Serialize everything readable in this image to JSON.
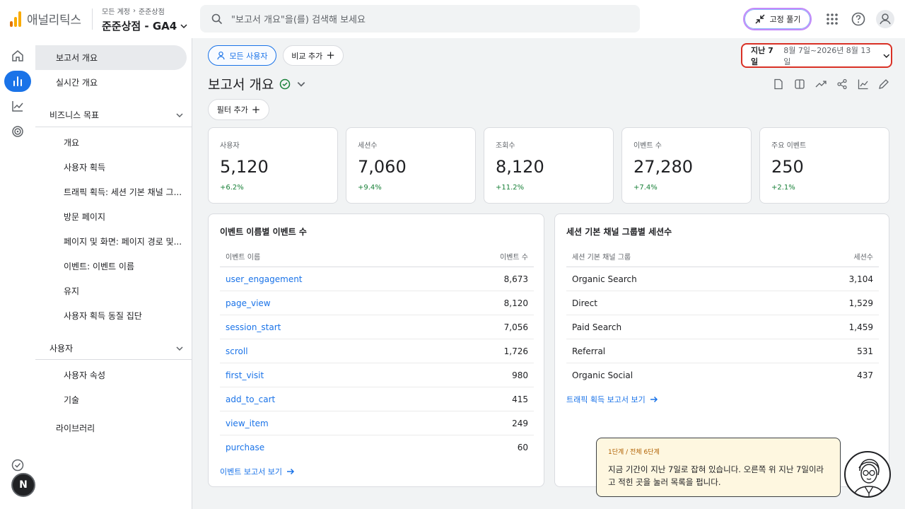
{
  "app": {
    "name": "애널리틱스",
    "crumb_root": "모든 계정",
    "crumb_sub": "준준상점",
    "property": "준준상점 - GA4"
  },
  "search": {
    "placeholder": "\"보고서 개요\"을(를) 검색해 보세요"
  },
  "header": {
    "pin_label": "고정 풀기"
  },
  "sidebar": {
    "overview": "보고서 개요",
    "realtime": "실시간 개요",
    "business_goals": "비즈니스 목표",
    "business_items": [
      "개요",
      "사용자 획득",
      "트래픽 획득: 세션 기본 채널 그...",
      "방문 페이지",
      "페이지 및 화면: 페이지 경로 및...",
      "이벤트: 이벤트 이름",
      "유지",
      "사용자 획득 동질 집단"
    ],
    "users_group": "사용자",
    "users_items": [
      "사용자 속성",
      "기술"
    ],
    "library": "라이브러리"
  },
  "filters": {
    "all_users": "모든 사용자",
    "add_compare": "비교 추가",
    "add_filter": "필터 추가"
  },
  "date_range": {
    "label": "지난 7일",
    "value": "8월 7일~2026년 8월 13일"
  },
  "page": {
    "title": "보고서 개요"
  },
  "kpis": [
    {
      "label": "사용자",
      "value": "5,120",
      "delta": "+6.2%"
    },
    {
      "label": "세션수",
      "value": "7,060",
      "delta": "+9.4%"
    },
    {
      "label": "조회수",
      "value": "8,120",
      "delta": "+11.2%"
    },
    {
      "label": "이벤트 수",
      "value": "27,280",
      "delta": "+7.4%"
    },
    {
      "label": "주요 이벤트",
      "value": "250",
      "delta": "+2.1%"
    }
  ],
  "events_card": {
    "title": "이벤트 이름별 이벤트 수",
    "col_name": "이벤트 이름",
    "col_value": "이벤트 수",
    "rows": [
      {
        "name": "user_engagement",
        "value": "8,673"
      },
      {
        "name": "page_view",
        "value": "8,120"
      },
      {
        "name": "session_start",
        "value": "7,056"
      },
      {
        "name": "scroll",
        "value": "1,726"
      },
      {
        "name": "first_visit",
        "value": "980"
      },
      {
        "name": "add_to_cart",
        "value": "415"
      },
      {
        "name": "view_item",
        "value": "249"
      },
      {
        "name": "purchase",
        "value": "60"
      }
    ],
    "link": "이벤트 보고서 보기"
  },
  "channels_card": {
    "title": "세션 기본 채널 그룹별 세션수",
    "col_name": "세션 기본 채널 그룹",
    "col_value": "세션수",
    "rows": [
      {
        "name": "Organic Search",
        "value": "3,104"
      },
      {
        "name": "Direct",
        "value": "1,529"
      },
      {
        "name": "Paid Search",
        "value": "1,459"
      },
      {
        "name": "Referral",
        "value": "531"
      },
      {
        "name": "Organic Social",
        "value": "437"
      }
    ],
    "link": "트래픽 획득 보고서 보기"
  },
  "coach": {
    "step": "1단계 / 전체 6단계",
    "text": "지금 기간이 지난 7일로 잡혀 있습니다. 오른쪽 위 지난 7일이라고 적힌 곳을 눌러 목록을 펍니다."
  },
  "badge": {
    "letter": "N"
  },
  "colors": {
    "accent": "#1a73e8",
    "positive": "#188038",
    "highlight": "#d93025",
    "coach_bg": "#fef7e0",
    "logo_orange": "#f9ab00",
    "logo_dark": "#e37400"
  }
}
